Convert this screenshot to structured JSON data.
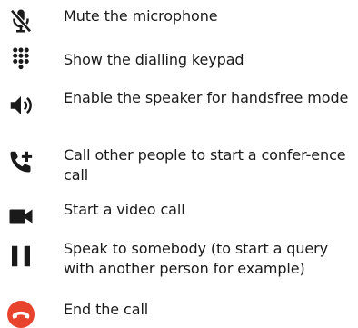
{
  "items": [
    {
      "icon": "mic-off-icon",
      "text": "Mute the microphone"
    },
    {
      "icon": "dialpad-icon",
      "text": "Show the dialling keypad"
    },
    {
      "icon": "speaker-icon",
      "text": "Enable the speaker for handsfree mode"
    },
    {
      "icon": "add-call-icon",
      "text": "Call other people to start a confer-ence call"
    },
    {
      "icon": "video-camera-icon",
      "text": "Start a video call"
    },
    {
      "icon": "pause-icon",
      "text": "Speak to somebody (to start a query with another person for example)"
    },
    {
      "icon": "end-call-icon",
      "text": "End the call"
    }
  ],
  "colors": {
    "icon": "#1a1a1a",
    "end_call": "#e8432d"
  }
}
